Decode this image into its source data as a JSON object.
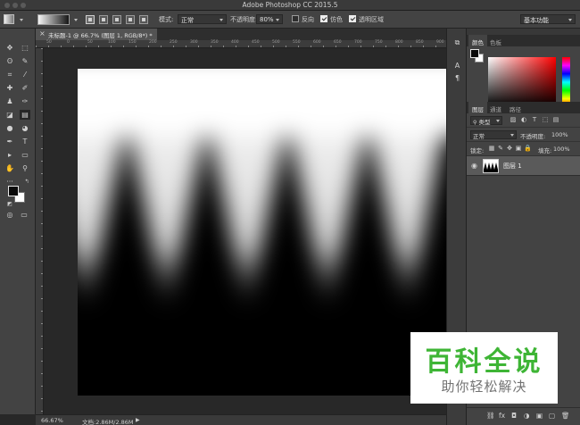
{
  "window": {
    "title": "Adobe Photoshop CC 2015.5"
  },
  "options": {
    "mode_label": "模式:",
    "mode_value": "正常",
    "opacity_label": "不透明度:",
    "opacity_value": "80%",
    "reverse_label": "反向",
    "reverse_checked": false,
    "dither_label": "仿色",
    "dither_checked": true,
    "transparency_label": "透明区域",
    "transparency_checked": true,
    "workspace_value": "基本功能"
  },
  "document": {
    "tab_label": "未标题-1 @ 66.7% (图层 1, RGB/8*) *",
    "close_symbol": "×"
  },
  "rulers": {
    "top_numbers": [
      "50",
      "0",
      "50",
      "100",
      "150",
      "200",
      "250",
      "300",
      "350",
      "400",
      "450",
      "500",
      "550",
      "600",
      "650",
      "700",
      "750",
      "800",
      "850",
      "900",
      "950"
    ]
  },
  "status": {
    "zoom": "66.67%",
    "doc_size": "文档:2.86M/2.86M",
    "arrow": "▶"
  },
  "tools": {
    "icons": [
      "move-icon",
      "marquee-icon",
      "lasso-icon",
      "quick-select-icon",
      "crop-icon",
      "eyedropper-icon",
      "healing-icon",
      "brush-icon",
      "stamp-icon",
      "history-brush-icon",
      "eraser-icon",
      "gradient-icon",
      "blur-icon",
      "dodge-icon",
      "pen-icon",
      "type-icon",
      "path-select-icon",
      "shape-icon",
      "hand-icon",
      "zoom-icon",
      "more-icon"
    ],
    "glyphs": [
      "✥",
      "⬚",
      "ʘ",
      "✎",
      "⌗",
      "⁄",
      "✚",
      "✐",
      "♟",
      "✑",
      "◪",
      "▤",
      "●",
      "◕",
      "✒",
      "T",
      "▸",
      "▭",
      "✋",
      "⚲",
      "···"
    ]
  },
  "colors": {
    "foreground": "#0a0a0a",
    "background": "#ffffff",
    "accent_green": "#3eb535"
  },
  "panels": {
    "color_tabs": [
      "颜色",
      "色板"
    ],
    "layer_tabs": [
      "图层",
      "通道",
      "路径"
    ],
    "filter_kind": "类型",
    "blend_mode": "正常",
    "opacity_label": "不透明度:",
    "opacity_value": "100%",
    "lock_label": "锁定:",
    "fill_label": "填充:",
    "fill_value": "100%",
    "layer_name": "图层 1",
    "footer_icons": [
      "link-icon",
      "fx-icon",
      "mask-icon",
      "adjustment-icon",
      "folder-icon",
      "new-layer-icon",
      "trash-icon"
    ],
    "footer_glyphs": [
      "⛓",
      "fx",
      "◘",
      "◑",
      "▣",
      "▢",
      "🗑"
    ]
  },
  "watermark": {
    "title": "百科全说",
    "subtitle": "助你轻松解决"
  }
}
